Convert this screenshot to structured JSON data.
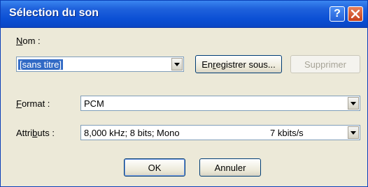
{
  "window": {
    "title": "Sélection du son",
    "help_glyph": "?",
    "colors": {
      "title_bar": "#0b4fd4",
      "close_button": "#c6401b",
      "help_button": "#2360d8",
      "dialog_bg": "#ece9d8"
    }
  },
  "name_section": {
    "label_prefix": "",
    "label_accel": "N",
    "label_rest": "om :",
    "value": "[sans titre]",
    "save_as_label_pre": "En",
    "save_as_label_accel": "r",
    "save_as_label_post": "egistrer sous...",
    "delete_label": "Supprimer"
  },
  "format": {
    "label_accel": "F",
    "label_rest": "ormat :",
    "value": "PCM"
  },
  "attributes": {
    "label_pre": "Attri",
    "label_accel": "b",
    "label_rest": "uts :",
    "value": "8,000 kHz; 8 bits; Mono",
    "rate": "7 kbits/s"
  },
  "footer": {
    "ok_label": "OK",
    "cancel_label": "Annuler"
  },
  "icons": {
    "help": "help-icon",
    "close": "close-icon",
    "dropdown": "chevron-down-icon"
  }
}
